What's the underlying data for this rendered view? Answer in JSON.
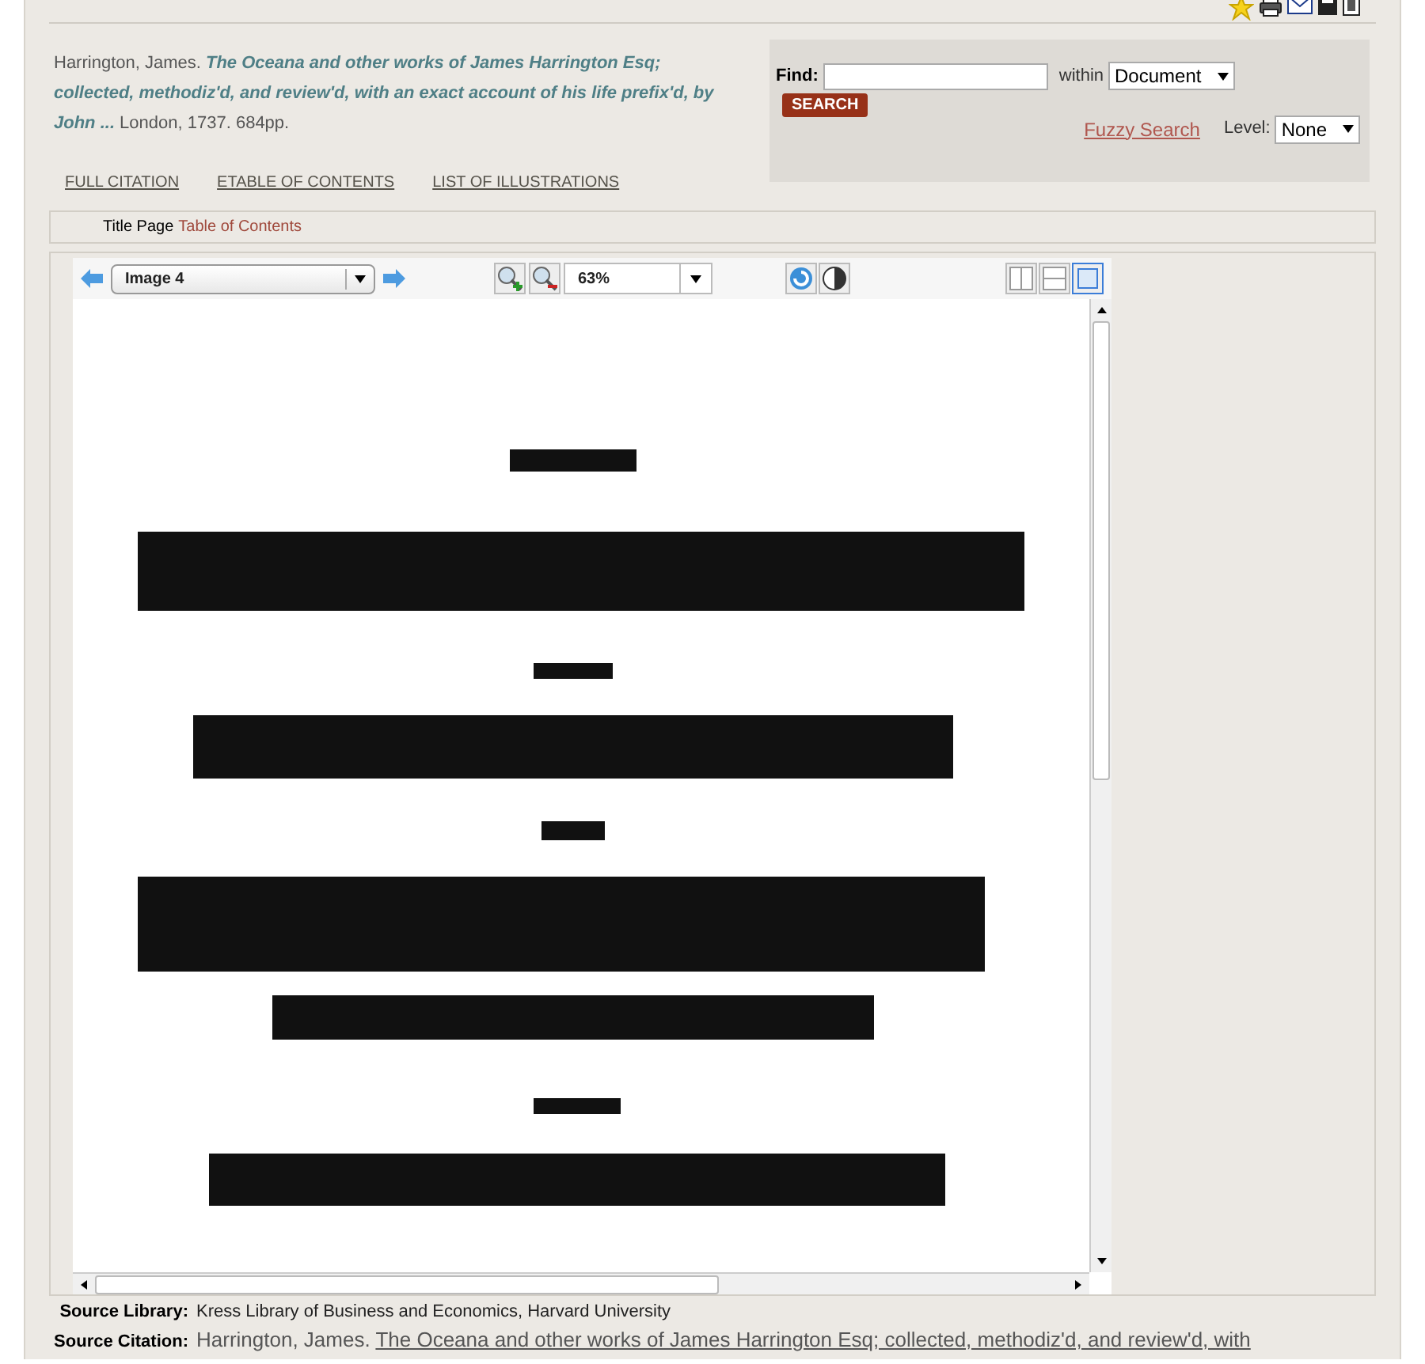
{
  "citation": {
    "author": "Harrington, James.",
    "title": "The Oceana and other works of James Harrington Esq; collected, methodiz'd, and review'd, with an exact account of his life prefix'd, by John ...",
    "imprint": "London, 1737. 684pp."
  },
  "links": [
    "FULL CITATION",
    "ETABLE OF CONTENTS",
    "LIST OF ILLUSTRATIONS"
  ],
  "search": {
    "find_label": "Find:",
    "within_label": "within",
    "within_value": "Document",
    "button": "SEARCH",
    "fuzzy": "Fuzzy Search",
    "level_label": "Level:",
    "level_value": "None"
  },
  "breadcrumb": [
    {
      "label": "Title Page",
      "selected": true
    },
    {
      "label": "Table of Contents",
      "selected": false
    }
  ],
  "viewer": {
    "image_select": "Image 4",
    "zoom": "63%"
  },
  "source": [
    {
      "label": "Source Library:",
      "value": "Kress Library of Business and Economics, Harvard University",
      "kind": "plain"
    },
    {
      "label": "Source Citation:",
      "prefix": "Harrington, James.",
      "value": "The Oceana and other works of James Harrington Esq; collected, methodiz'd, and review'd, with",
      "kind": "link"
    }
  ]
}
